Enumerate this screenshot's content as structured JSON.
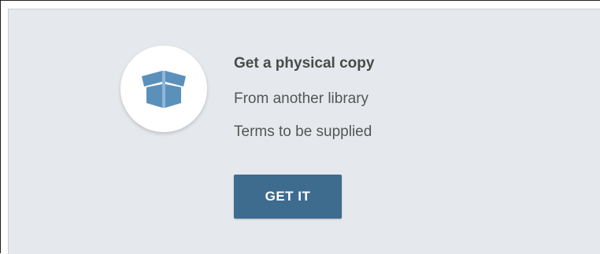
{
  "offer": {
    "icon": "open-box-icon",
    "title": "Get a physical copy",
    "subtitle": "From another library",
    "terms": "Terms to be supplied",
    "button_label": "GET IT"
  },
  "colors": {
    "panel_background": "#e5e9ed",
    "icon_blue": "#5b90bb",
    "button_background": "#3e6c8f",
    "button_text": "#ffffff",
    "title_text": "#4a4a4a",
    "body_text": "#555555"
  }
}
